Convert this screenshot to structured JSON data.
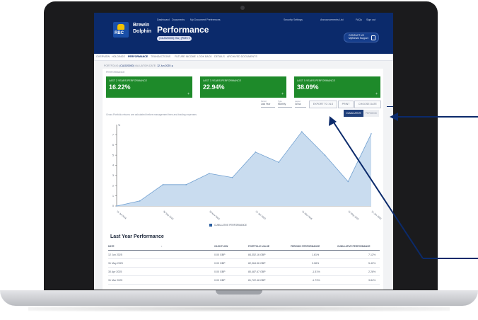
{
  "brand": {
    "line1": "Brewin",
    "line2": "Dolphin",
    "logo_text": "RBC"
  },
  "top_nav": [
    "Dashboard",
    "Documents",
    "My Document Preferences"
  ],
  "top_right_nav": [
    "Security Settings",
    "Announcements List",
    "FAQs",
    "Sign out"
  ],
  "page_title": "Performance",
  "account_chip": "(CAJ020000) ISA | (PIMS ▾",
  "contact": {
    "line1": "CONTACT US",
    "line2": "MyBrewin Support"
  },
  "tabs": [
    "OVERVIEW",
    "HOLDINGS",
    "PERFORMANCE",
    "TRANSACTIONS",
    "FUTURE INCOME",
    "LOOK BACK",
    "DETAILS",
    "ARCHIVED DOCUMENTS"
  ],
  "active_tab": "PERFORMANCE",
  "crumb": {
    "portfolio_label": "PORTFOLIO:",
    "portfolio": "(CAJ020000)",
    "valuation_label": "VALUATION DATE:",
    "valuation": "12 Jun 2025"
  },
  "panel_title": "PERFORMANCE",
  "perf_cards": [
    {
      "label": "LAST 2 YEARS PERFORMANCE",
      "value": "16.22%"
    },
    {
      "label": "LAST 3 YEARS PERFORMANCE",
      "value": "22.94%"
    },
    {
      "label": "LAST 5 YEARS PERFORMANCE",
      "value": "38.09%"
    }
  ],
  "selects": [
    {
      "label": "Period",
      "value": "Last Year"
    },
    {
      "label": "Type",
      "value": "Monthly"
    },
    {
      "label": "Layout",
      "value": "Gross"
    }
  ],
  "buttons": {
    "export": "EXPORT TO XLS",
    "print": "PRINT",
    "choose_date": "CHOOSE DATE"
  },
  "toggle": {
    "cumulative": "CUMULATIVE",
    "periodic": "PERIODIC"
  },
  "disclaimer": "Gross Portfolio returns are calculated before management fees and trading expenses",
  "colors": {
    "header": "#0b2a6b",
    "card_green": "#1e8a2a",
    "area_fill": "#c9dcef",
    "area_line": "#6f9fd0"
  },
  "chart_data": {
    "type": "area",
    "x": [
      "31 Jul 2024",
      "31 Aug 2024",
      "30 Sep 2024",
      "31 Oct 2024",
      "30 Nov 2024",
      "31 Dec 2024",
      "31 Jan 2025",
      "28 Feb 2025",
      "31 Mar 2025",
      "30 Apr 2025",
      "31 May 2025",
      "12 Jun 2025"
    ],
    "x_tick_labels": [
      "31 Jul 2024",
      "",
      "30 Sep 2024",
      "",
      "30 Nov 2024",
      "",
      "31 Jan 2025",
      "",
      "31 Mar 2025",
      "",
      "31 May 2025",
      "12 Jun 2025"
    ],
    "series": [
      {
        "name": "CUMULATIVE PERFORMANCE",
        "values": [
          0.0,
          0.5,
          2.1,
          2.1,
          3.2,
          2.8,
          5.3,
          4.3,
          7.3,
          5.0,
          2.4,
          7.1
        ]
      }
    ],
    "yticks": [
      0,
      1,
      2,
      3,
      4,
      5,
      6,
      7
    ],
    "ylim": [
      0,
      8
    ],
    "ylabel": "%",
    "grid": false,
    "legend": "bottom"
  },
  "table": {
    "title": "Last Year Performance",
    "headers": [
      "DATE",
      "CASH FLOW",
      "PORTFOLIO VALUE",
      "PERIODIC PERFORMANCE",
      "CUMULATIVE PERFORMANCE"
    ],
    "rows": [
      [
        "12 Jun 2025",
        "0.00 GBP",
        "84,352.16 GBP",
        "1.61%",
        "7.12%"
      ],
      [
        "31 May 2025",
        "0.00 GBP",
        "82,964.56 GBP",
        "3.08%",
        "5.42%"
      ],
      [
        "30 Apr 2025",
        "0.00 GBP",
        "80,487.67 GBP",
        "-1.51%",
        "2.28%"
      ],
      [
        "31 Mar 2025",
        "0.00 GBP",
        "81,722.48 GBP",
        "-1.73%",
        "3.84%"
      ]
    ]
  }
}
